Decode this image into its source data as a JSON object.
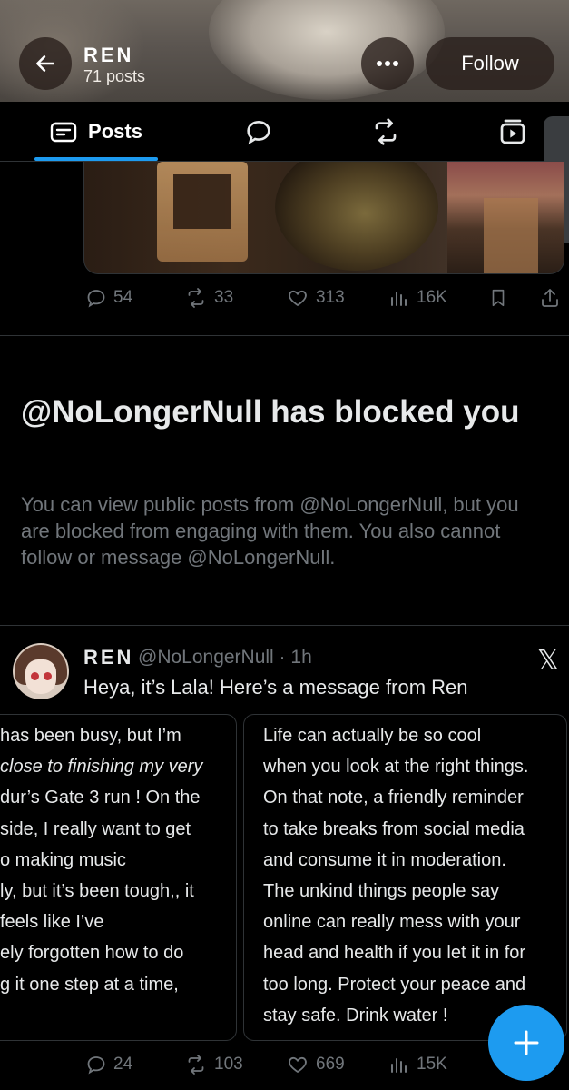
{
  "header": {
    "name": "REN",
    "post_count": "71 posts",
    "follow_label": "Follow"
  },
  "tabs": [
    {
      "label": "Posts",
      "icon": "posts-icon",
      "active": true
    },
    {
      "label": "",
      "icon": "replies-icon"
    },
    {
      "label": "",
      "icon": "reposts-icon"
    },
    {
      "label": "",
      "icon": "media-icon"
    }
  ],
  "prev_post": {
    "replies": "54",
    "reposts": "33",
    "likes": "313",
    "views": "16K"
  },
  "blocked": {
    "title": "@NoLongerNull has blocked you",
    "body": "You can view public posts from @NoLongerNull, but you are blocked from engaging with them. You also cannot follow or message @NoLongerNull."
  },
  "tweet": {
    "name": "REN",
    "handle_time": "@NoLongerNull · 1h",
    "text": "Heya, it’s Lala! Here’s a message from Ren",
    "card_left_lines": [
      "has been busy, but I’m",
      "close to finishing my very",
      "dur’s Gate 3 run ! On the",
      "side, I really want to get",
      "o making music",
      "ly, but it’s been tough,, it",
      "feels like I’ve",
      "ely forgotten how to do",
      "g it one step at a time,"
    ],
    "card_right_lines": [
      "Life can actually be so cool",
      "when you look at the right things.",
      "On that note, a friendly reminder",
      "to take breaks from social media",
      "and consume it in moderation.",
      "The unkind things people say",
      "online can really mess with your",
      "head and health if you let it in for",
      "too long. Protect your peace and",
      "stay safe. Drink water !"
    ],
    "replies": "24",
    "reposts": "103",
    "likes": "669",
    "views": "15K"
  },
  "colors": {
    "accent": "#1d9bf0",
    "muted": "#71767b",
    "text": "#e7e9ea",
    "background": "#000000"
  }
}
